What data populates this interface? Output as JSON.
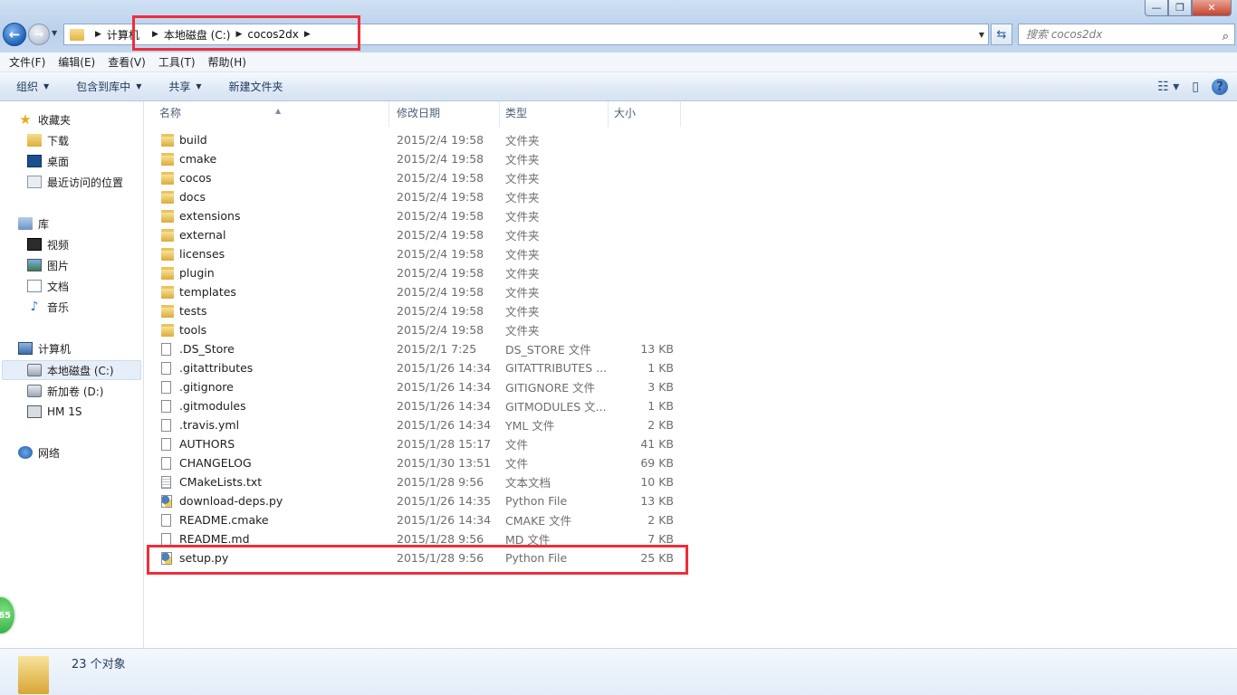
{
  "window": {
    "controls": [
      "—",
      "❐",
      "✕"
    ]
  },
  "address": {
    "crumbs": [
      "计算机",
      "本地磁盘 (C:)",
      "cocos2dx"
    ],
    "search_placeholder": "搜索 cocos2dx"
  },
  "menu": [
    "文件(F)",
    "编辑(E)",
    "查看(V)",
    "工具(T)",
    "帮助(H)"
  ],
  "toolbar": {
    "organize": "组织",
    "include_library": "包含到库中",
    "share": "共享",
    "new_folder": "新建文件夹",
    "help": "?"
  },
  "sidebar": {
    "favorites": {
      "label": "收藏夹",
      "items": [
        "下载",
        "桌面",
        "最近访问的位置"
      ]
    },
    "libraries": {
      "label": "库",
      "items": [
        "视频",
        "图片",
        "文档",
        "音乐"
      ]
    },
    "computer": {
      "label": "计算机",
      "items": [
        "本地磁盘 (C:)",
        "新加卷 (D:)",
        "HM 1S"
      ]
    },
    "network": {
      "label": "网络"
    },
    "badge": "65"
  },
  "columns": {
    "name": "名称",
    "modified": "修改日期",
    "type": "类型",
    "size": "大小"
  },
  "files": [
    {
      "name": "build",
      "date": "2015/2/4 19:58",
      "type": "文件夹",
      "size": "",
      "icon": "folder"
    },
    {
      "name": "cmake",
      "date": "2015/2/4 19:58",
      "type": "文件夹",
      "size": "",
      "icon": "folder"
    },
    {
      "name": "cocos",
      "date": "2015/2/4 19:58",
      "type": "文件夹",
      "size": "",
      "icon": "folder"
    },
    {
      "name": "docs",
      "date": "2015/2/4 19:58",
      "type": "文件夹",
      "size": "",
      "icon": "folder"
    },
    {
      "name": "extensions",
      "date": "2015/2/4 19:58",
      "type": "文件夹",
      "size": "",
      "icon": "folder"
    },
    {
      "name": "external",
      "date": "2015/2/4 19:58",
      "type": "文件夹",
      "size": "",
      "icon": "folder"
    },
    {
      "name": "licenses",
      "date": "2015/2/4 19:58",
      "type": "文件夹",
      "size": "",
      "icon": "folder"
    },
    {
      "name": "plugin",
      "date": "2015/2/4 19:58",
      "type": "文件夹",
      "size": "",
      "icon": "folder"
    },
    {
      "name": "templates",
      "date": "2015/2/4 19:58",
      "type": "文件夹",
      "size": "",
      "icon": "folder"
    },
    {
      "name": "tests",
      "date": "2015/2/4 19:58",
      "type": "文件夹",
      "size": "",
      "icon": "folder"
    },
    {
      "name": "tools",
      "date": "2015/2/4 19:58",
      "type": "文件夹",
      "size": "",
      "icon": "folder"
    },
    {
      "name": ".DS_Store",
      "date": "2015/2/1 7:25",
      "type": "DS_STORE 文件",
      "size": "13 KB",
      "icon": "file"
    },
    {
      "name": ".gitattributes",
      "date": "2015/1/26 14:34",
      "type": "GITATTRIBUTES ...",
      "size": "1 KB",
      "icon": "file"
    },
    {
      "name": ".gitignore",
      "date": "2015/1/26 14:34",
      "type": "GITIGNORE 文件",
      "size": "3 KB",
      "icon": "file"
    },
    {
      "name": ".gitmodules",
      "date": "2015/1/26 14:34",
      "type": "GITMODULES 文...",
      "size": "1 KB",
      "icon": "file"
    },
    {
      "name": ".travis.yml",
      "date": "2015/1/26 14:34",
      "type": "YML 文件",
      "size": "2 KB",
      "icon": "file"
    },
    {
      "name": "AUTHORS",
      "date": "2015/1/28 15:17",
      "type": "文件",
      "size": "41 KB",
      "icon": "file"
    },
    {
      "name": "CHANGELOG",
      "date": "2015/1/30 13:51",
      "type": "文件",
      "size": "69 KB",
      "icon": "file"
    },
    {
      "name": "CMakeLists.txt",
      "date": "2015/1/28 9:56",
      "type": "文本文档",
      "size": "10 KB",
      "icon": "txt"
    },
    {
      "name": "download-deps.py",
      "date": "2015/1/26 14:35",
      "type": "Python File",
      "size": "13 KB",
      "icon": "py"
    },
    {
      "name": "README.cmake",
      "date": "2015/1/26 14:34",
      "type": "CMAKE 文件",
      "size": "2 KB",
      "icon": "file"
    },
    {
      "name": "README.md",
      "date": "2015/1/28 9:56",
      "type": "MD 文件",
      "size": "7 KB",
      "icon": "file"
    },
    {
      "name": "setup.py",
      "date": "2015/1/28 9:56",
      "type": "Python File",
      "size": "25 KB",
      "icon": "py"
    }
  ],
  "status": {
    "count": "23 个对象"
  },
  "colors": {
    "highlight": "#ee2e3a",
    "accent": "#1e395b"
  }
}
